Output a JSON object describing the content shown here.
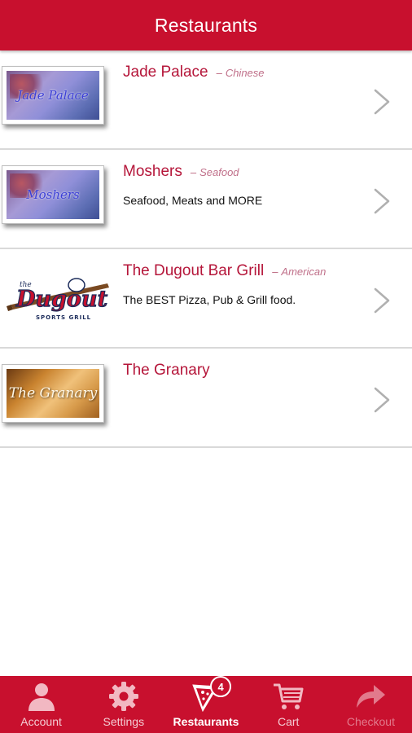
{
  "header": {
    "title": "Restaurants"
  },
  "restaurants": [
    {
      "name": "Jade Palace",
      "separator": "–",
      "cuisine": "Chinese",
      "description": "",
      "thumb_text": "Jade Palace"
    },
    {
      "name": "Moshers",
      "separator": "–",
      "cuisine": "Seafood",
      "description": "Seafood, Meats and MORE",
      "thumb_text": "Moshers"
    },
    {
      "name": "The Dugout Bar Grill",
      "separator": "–",
      "cuisine": "American",
      "description": "The BEST Pizza, Pub & Grill food.",
      "logo_text": "Dugout",
      "logo_small": "the",
      "logo_sub": "SPORTS GRILL"
    },
    {
      "name": "The Granary",
      "separator": "",
      "cuisine": "",
      "description": "",
      "thumb_text": "The Granary"
    }
  ],
  "tabbar": {
    "tabs": [
      {
        "label": "Account",
        "icon": "person-icon"
      },
      {
        "label": "Settings",
        "icon": "gear-icon"
      },
      {
        "label": "Restaurants",
        "icon": "pizza-slice-icon",
        "badge": "4",
        "active": true
      },
      {
        "label": "Cart",
        "icon": "cart-icon"
      },
      {
        "label": "Checkout",
        "icon": "forward-arrow-icon",
        "disabled": true
      }
    ]
  },
  "colors": {
    "brand": "#c8102e",
    "name_text": "#b5163a",
    "divider": "#d9d9d9"
  }
}
